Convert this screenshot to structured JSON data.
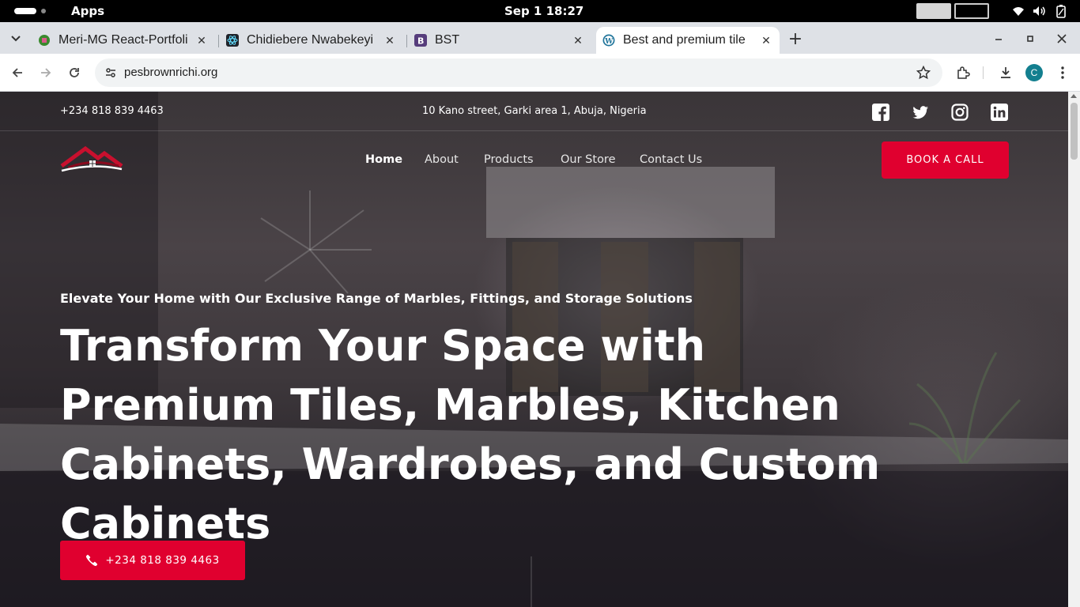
{
  "system": {
    "activities_label": "Apps",
    "clock": "Sep 1  18:27"
  },
  "browser": {
    "tabs": [
      {
        "title": "Meri-MG React-Portfoli",
        "favicon": "green-leaf-icon"
      },
      {
        "title": "Chidiebere Nwabekeyi",
        "favicon": "react-icon"
      },
      {
        "title": "BST",
        "favicon": "bootstrap-icon"
      },
      {
        "title": "Best and premium tile",
        "favicon": "wordpress-icon",
        "active": true
      }
    ],
    "url": "pesbrownrichi.org",
    "profile_initial": "C"
  },
  "site": {
    "infobar": {
      "phone": "+234 818 839 4463",
      "address": "10 Kano street, Garki area 1, Abuja, Nigeria",
      "social": [
        "facebook-icon",
        "twitter-icon",
        "instagram-icon",
        "linkedin-icon"
      ]
    },
    "nav": {
      "items": [
        {
          "label": "Home",
          "active": true
        },
        {
          "label": "About"
        },
        {
          "label": "Products"
        },
        {
          "label": "Our Store"
        },
        {
          "label": "Contact Us"
        }
      ],
      "cta": "BOOK A CALL"
    },
    "hero": {
      "tagline": "Elevate Your Home with Our Exclusive Range of Marbles, Fittings, and Storage Solutions",
      "headline": "Transform Your Space with Premium Tiles, Marbles, Kitchen Cabinets, Wardrobes, and Custom Cabinets",
      "call_button": "+234 818 839 4463"
    }
  },
  "colors": {
    "accent": "#e0002f",
    "logo_red": "#c8102e"
  }
}
